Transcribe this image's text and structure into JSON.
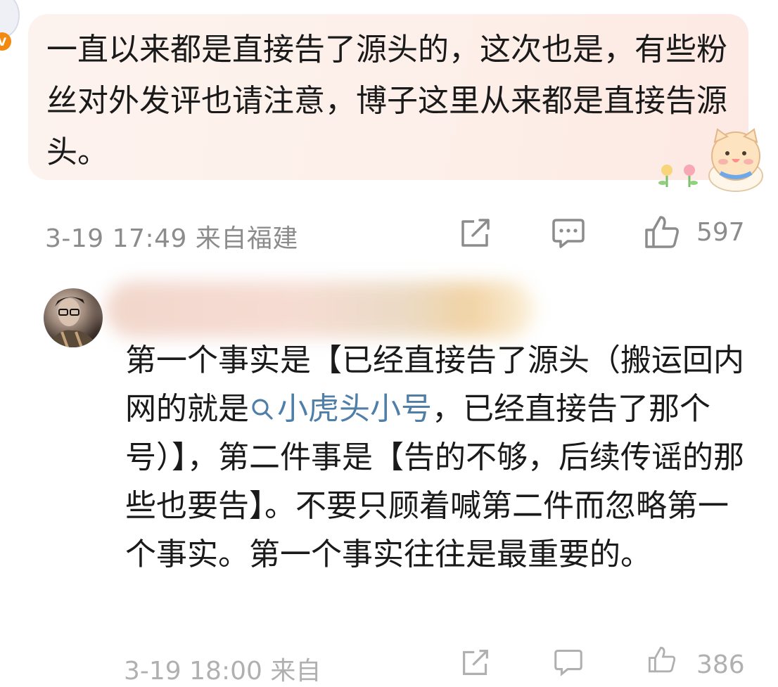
{
  "comment1": {
    "text": "一直以来都是直接告了源头的，这次也是，有些粉丝对外发评也请注意，博子这里从来都是直接告源头。",
    "vip_badge": "V",
    "meta": "3-19 17:49 来自福建",
    "likes": "597"
  },
  "comment2": {
    "text_before": "第一个事实是【已经直接告了源头（搬运回内网的就是",
    "topic_link": "小虎头小号",
    "text_after": "，已经直接告了那个号）】，第二件事是【告的不够，后续传谣的那些也要告】。不要只顾着喊第二件而忽略第一个事实。第一个事实往往是最重要的。",
    "meta": "3-19 18:00 来自",
    "likes": "386"
  },
  "icons": {
    "share": "share-icon",
    "comment": "comment-icon",
    "like": "thumbs-up-icon",
    "search": "search-icon"
  },
  "colors": {
    "topic_link": "#4f7fa8",
    "meta_text": "#8c8c8c",
    "bubble_bg": "#fdf0ea",
    "vip_badge": "#f28a12"
  }
}
